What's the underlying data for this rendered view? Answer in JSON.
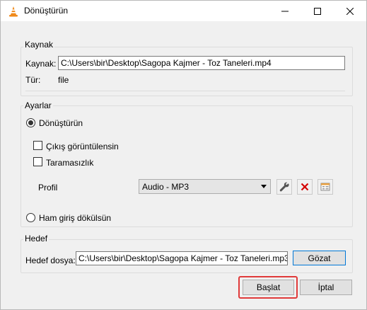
{
  "window": {
    "title": "Dönüştürün"
  },
  "source": {
    "group_label": "Kaynak",
    "source_label": "Kaynak:",
    "source_value": "C:\\Users\\bir\\Desktop\\Sagopa Kajmer - Toz Taneleri.mp4",
    "type_label": "Tür:",
    "type_value": "file"
  },
  "settings": {
    "group_label": "Ayarlar",
    "convert_option": "Dönüştürün",
    "show_output": "Çıkış görüntülensin",
    "deinterlace": "Taramasızlık",
    "profile_label": "Profil",
    "profile_value": "Audio - MP3",
    "raw_dump_option": "Ham giriş dökülsün"
  },
  "destination": {
    "group_label": "Hedef",
    "file_label": "Hedef dosya:",
    "file_value": "C:\\Users\\bir\\Desktop\\Sagopa Kajmer - Toz Taneleri.mp3",
    "browse_label": "Gözat"
  },
  "footer": {
    "start_label": "Başlat",
    "cancel_label": "İptal"
  },
  "colors": {
    "highlight": "#e03a3a",
    "delete_icon": "#d40000",
    "vlc_orange": "#f08a1a"
  },
  "icons": [
    "vlc-cone-icon",
    "minimize-icon",
    "maximize-icon",
    "close-icon",
    "wrench-icon",
    "delete-icon",
    "new-profile-icon",
    "dropdown-arrow-icon"
  ]
}
